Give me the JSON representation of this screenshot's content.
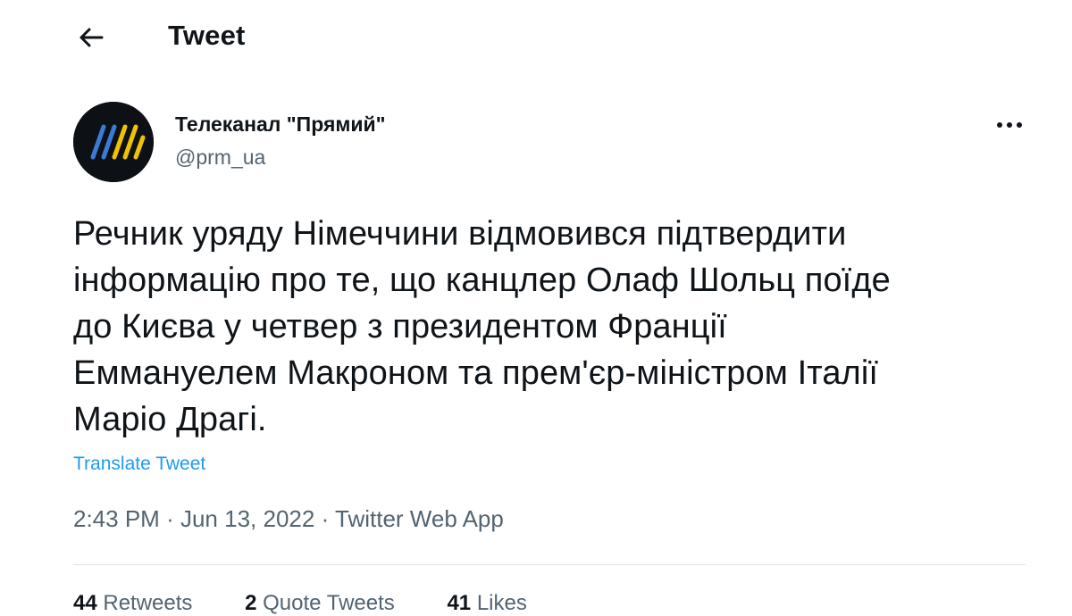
{
  "header": {
    "title": "Tweet",
    "back_icon": "arrow-left-icon"
  },
  "author": {
    "name": "Телеканал \"Прямий\"",
    "handle": "@prm_ua",
    "avatar_colors": [
      "#3a7bd5",
      "#f2c200"
    ]
  },
  "tweet": {
    "lines": [
      "Речник уряду Німеччини відмовився підтвердити",
      "інформацію про те, що канцлер Олаф Шольц поїде",
      "до Києва у четвер з президентом Франції",
      "Еммануелем Макроном та прем'єр-міністром Італії",
      "Маріо Драгі."
    ],
    "translate_label": "Translate Tweet"
  },
  "meta": {
    "time": "2:43 PM",
    "date": "Jun 13, 2022",
    "separator": "·",
    "app": "Twitter Web App"
  },
  "stats": {
    "retweets_count": "44",
    "retweets_label": "Retweets",
    "quotes_count": "2",
    "quotes_label": "Quote Tweets",
    "likes_count": "41",
    "likes_label": "Likes"
  },
  "colors": {
    "text": "#0f1419",
    "secondary": "#536471",
    "link": "#1d9bf0"
  }
}
